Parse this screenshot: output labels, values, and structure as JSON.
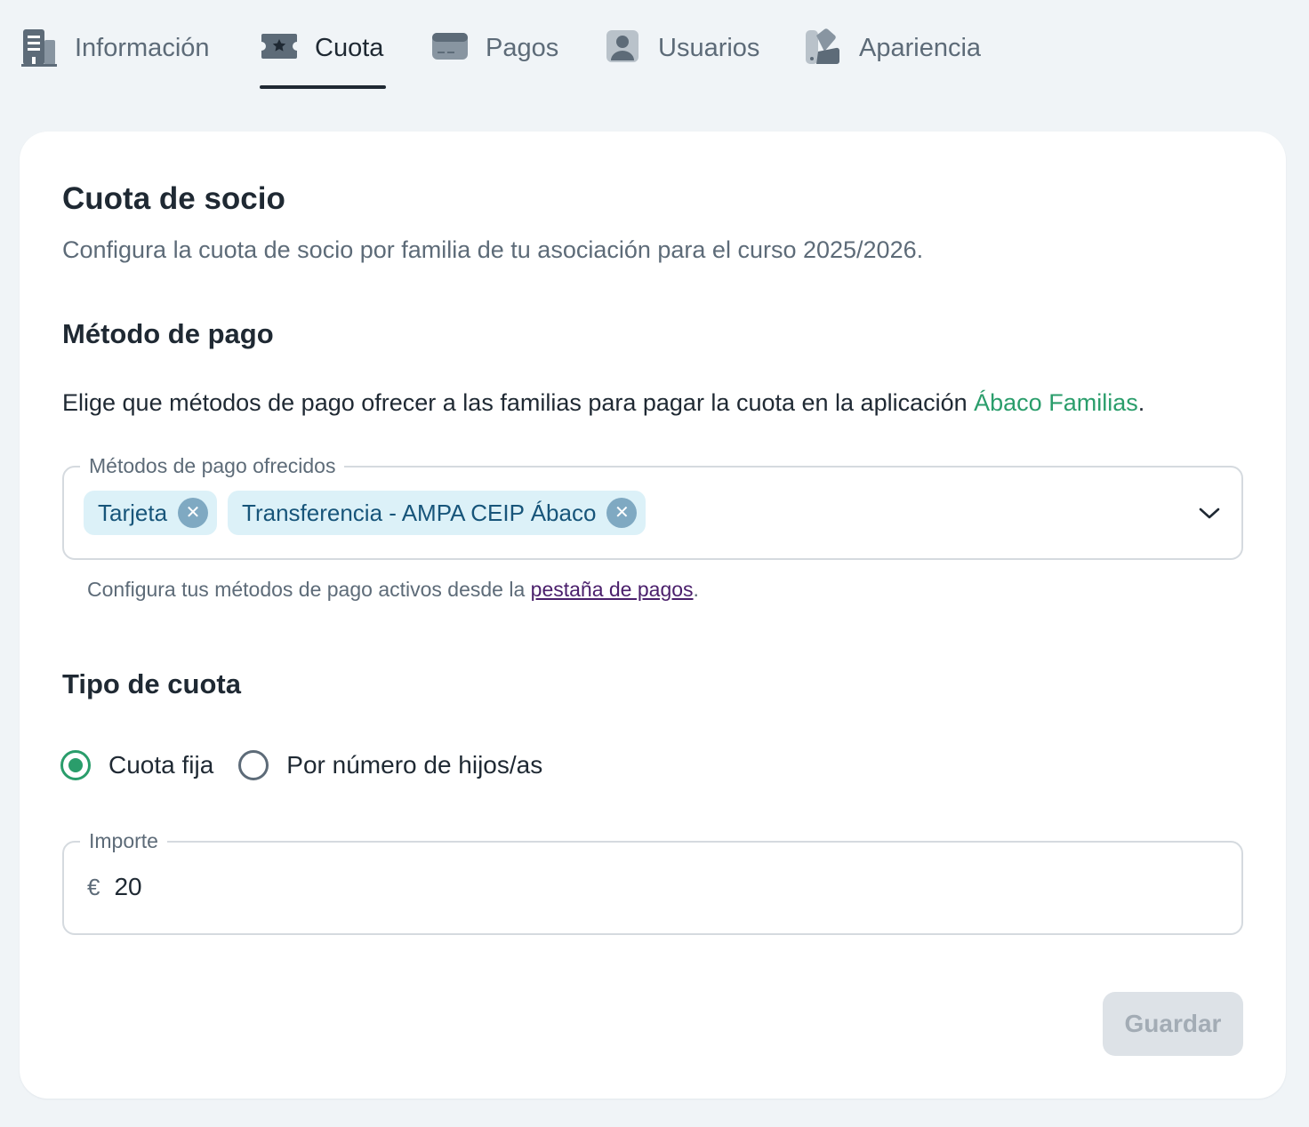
{
  "tabs": [
    {
      "label": "Información",
      "icon": "building-icon",
      "active": false
    },
    {
      "label": "Cuota",
      "icon": "ticket-icon",
      "active": true
    },
    {
      "label": "Pagos",
      "icon": "credit-card-icon",
      "active": false
    },
    {
      "label": "Usuarios",
      "icon": "user-icon",
      "active": false
    },
    {
      "label": "Apariencia",
      "icon": "palette-icon",
      "active": false
    }
  ],
  "card": {
    "title": "Cuota de socio",
    "subtitle": "Configura la cuota de socio por familia de tu asociación para el curso 2025/2026."
  },
  "payment": {
    "section_title": "Método de pago",
    "description": "Elige que métodos de pago ofrecer a las familias para pagar la cuota en la aplicación ",
    "brand": "Ábaco Familias",
    "description_end": ".",
    "field_label": "Métodos de pago ofrecidos",
    "selected": [
      {
        "label": "Tarjeta"
      },
      {
        "label": "Transferencia - AMPA CEIP Ábaco"
      }
    ],
    "helper_text": "Configura tus métodos de pago activos desde la ",
    "helper_link": "pestaña de pagos",
    "helper_end": "."
  },
  "fee_type": {
    "section_title": "Tipo de cuota",
    "options": [
      {
        "label": "Cuota fija",
        "checked": true
      },
      {
        "label": "Por número de hijos/as",
        "checked": false
      }
    ]
  },
  "amount": {
    "field_label": "Importe",
    "currency": "€",
    "value": "20"
  },
  "save_button": "Guardar",
  "colors": {
    "accent_green": "#2a9d6b",
    "chip_bg": "#dcf1f8",
    "chip_text": "#17557a",
    "link": "#4a1f6b",
    "disabled_button": "#dde2e7"
  }
}
